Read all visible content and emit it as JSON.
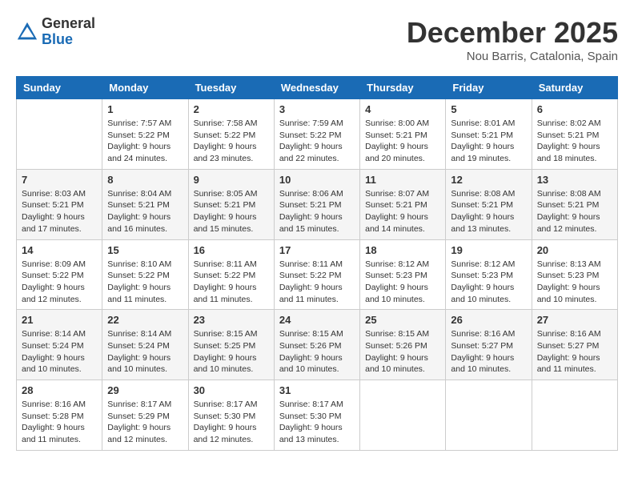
{
  "logo": {
    "general": "General",
    "blue": "Blue"
  },
  "title": "December 2025",
  "location": "Nou Barris, Catalonia, Spain",
  "days_of_week": [
    "Sunday",
    "Monday",
    "Tuesday",
    "Wednesday",
    "Thursday",
    "Friday",
    "Saturday"
  ],
  "weeks": [
    [
      {
        "day": "",
        "sunrise": "",
        "sunset": "",
        "daylight": ""
      },
      {
        "day": "1",
        "sunrise": "Sunrise: 7:57 AM",
        "sunset": "Sunset: 5:22 PM",
        "daylight": "Daylight: 9 hours and 24 minutes."
      },
      {
        "day": "2",
        "sunrise": "Sunrise: 7:58 AM",
        "sunset": "Sunset: 5:22 PM",
        "daylight": "Daylight: 9 hours and 23 minutes."
      },
      {
        "day": "3",
        "sunrise": "Sunrise: 7:59 AM",
        "sunset": "Sunset: 5:22 PM",
        "daylight": "Daylight: 9 hours and 22 minutes."
      },
      {
        "day": "4",
        "sunrise": "Sunrise: 8:00 AM",
        "sunset": "Sunset: 5:21 PM",
        "daylight": "Daylight: 9 hours and 20 minutes."
      },
      {
        "day": "5",
        "sunrise": "Sunrise: 8:01 AM",
        "sunset": "Sunset: 5:21 PM",
        "daylight": "Daylight: 9 hours and 19 minutes."
      },
      {
        "day": "6",
        "sunrise": "Sunrise: 8:02 AM",
        "sunset": "Sunset: 5:21 PM",
        "daylight": "Daylight: 9 hours and 18 minutes."
      }
    ],
    [
      {
        "day": "7",
        "sunrise": "Sunrise: 8:03 AM",
        "sunset": "Sunset: 5:21 PM",
        "daylight": "Daylight: 9 hours and 17 minutes."
      },
      {
        "day": "8",
        "sunrise": "Sunrise: 8:04 AM",
        "sunset": "Sunset: 5:21 PM",
        "daylight": "Daylight: 9 hours and 16 minutes."
      },
      {
        "day": "9",
        "sunrise": "Sunrise: 8:05 AM",
        "sunset": "Sunset: 5:21 PM",
        "daylight": "Daylight: 9 hours and 15 minutes."
      },
      {
        "day": "10",
        "sunrise": "Sunrise: 8:06 AM",
        "sunset": "Sunset: 5:21 PM",
        "daylight": "Daylight: 9 hours and 15 minutes."
      },
      {
        "day": "11",
        "sunrise": "Sunrise: 8:07 AM",
        "sunset": "Sunset: 5:21 PM",
        "daylight": "Daylight: 9 hours and 14 minutes."
      },
      {
        "day": "12",
        "sunrise": "Sunrise: 8:08 AM",
        "sunset": "Sunset: 5:21 PM",
        "daylight": "Daylight: 9 hours and 13 minutes."
      },
      {
        "day": "13",
        "sunrise": "Sunrise: 8:08 AM",
        "sunset": "Sunset: 5:21 PM",
        "daylight": "Daylight: 9 hours and 12 minutes."
      }
    ],
    [
      {
        "day": "14",
        "sunrise": "Sunrise: 8:09 AM",
        "sunset": "Sunset: 5:22 PM",
        "daylight": "Daylight: 9 hours and 12 minutes."
      },
      {
        "day": "15",
        "sunrise": "Sunrise: 8:10 AM",
        "sunset": "Sunset: 5:22 PM",
        "daylight": "Daylight: 9 hours and 11 minutes."
      },
      {
        "day": "16",
        "sunrise": "Sunrise: 8:11 AM",
        "sunset": "Sunset: 5:22 PM",
        "daylight": "Daylight: 9 hours and 11 minutes."
      },
      {
        "day": "17",
        "sunrise": "Sunrise: 8:11 AM",
        "sunset": "Sunset: 5:22 PM",
        "daylight": "Daylight: 9 hours and 11 minutes."
      },
      {
        "day": "18",
        "sunrise": "Sunrise: 8:12 AM",
        "sunset": "Sunset: 5:23 PM",
        "daylight": "Daylight: 9 hours and 10 minutes."
      },
      {
        "day": "19",
        "sunrise": "Sunrise: 8:12 AM",
        "sunset": "Sunset: 5:23 PM",
        "daylight": "Daylight: 9 hours and 10 minutes."
      },
      {
        "day": "20",
        "sunrise": "Sunrise: 8:13 AM",
        "sunset": "Sunset: 5:23 PM",
        "daylight": "Daylight: 9 hours and 10 minutes."
      }
    ],
    [
      {
        "day": "21",
        "sunrise": "Sunrise: 8:14 AM",
        "sunset": "Sunset: 5:24 PM",
        "daylight": "Daylight: 9 hours and 10 minutes."
      },
      {
        "day": "22",
        "sunrise": "Sunrise: 8:14 AM",
        "sunset": "Sunset: 5:24 PM",
        "daylight": "Daylight: 9 hours and 10 minutes."
      },
      {
        "day": "23",
        "sunrise": "Sunrise: 8:15 AM",
        "sunset": "Sunset: 5:25 PM",
        "daylight": "Daylight: 9 hours and 10 minutes."
      },
      {
        "day": "24",
        "sunrise": "Sunrise: 8:15 AM",
        "sunset": "Sunset: 5:26 PM",
        "daylight": "Daylight: 9 hours and 10 minutes."
      },
      {
        "day": "25",
        "sunrise": "Sunrise: 8:15 AM",
        "sunset": "Sunset: 5:26 PM",
        "daylight": "Daylight: 9 hours and 10 minutes."
      },
      {
        "day": "26",
        "sunrise": "Sunrise: 8:16 AM",
        "sunset": "Sunset: 5:27 PM",
        "daylight": "Daylight: 9 hours and 10 minutes."
      },
      {
        "day": "27",
        "sunrise": "Sunrise: 8:16 AM",
        "sunset": "Sunset: 5:27 PM",
        "daylight": "Daylight: 9 hours and 11 minutes."
      }
    ],
    [
      {
        "day": "28",
        "sunrise": "Sunrise: 8:16 AM",
        "sunset": "Sunset: 5:28 PM",
        "daylight": "Daylight: 9 hours and 11 minutes."
      },
      {
        "day": "29",
        "sunrise": "Sunrise: 8:17 AM",
        "sunset": "Sunset: 5:29 PM",
        "daylight": "Daylight: 9 hours and 12 minutes."
      },
      {
        "day": "30",
        "sunrise": "Sunrise: 8:17 AM",
        "sunset": "Sunset: 5:30 PM",
        "daylight": "Daylight: 9 hours and 12 minutes."
      },
      {
        "day": "31",
        "sunrise": "Sunrise: 8:17 AM",
        "sunset": "Sunset: 5:30 PM",
        "daylight": "Daylight: 9 hours and 13 minutes."
      },
      {
        "day": "",
        "sunrise": "",
        "sunset": "",
        "daylight": ""
      },
      {
        "day": "",
        "sunrise": "",
        "sunset": "",
        "daylight": ""
      },
      {
        "day": "",
        "sunrise": "",
        "sunset": "",
        "daylight": ""
      }
    ]
  ]
}
